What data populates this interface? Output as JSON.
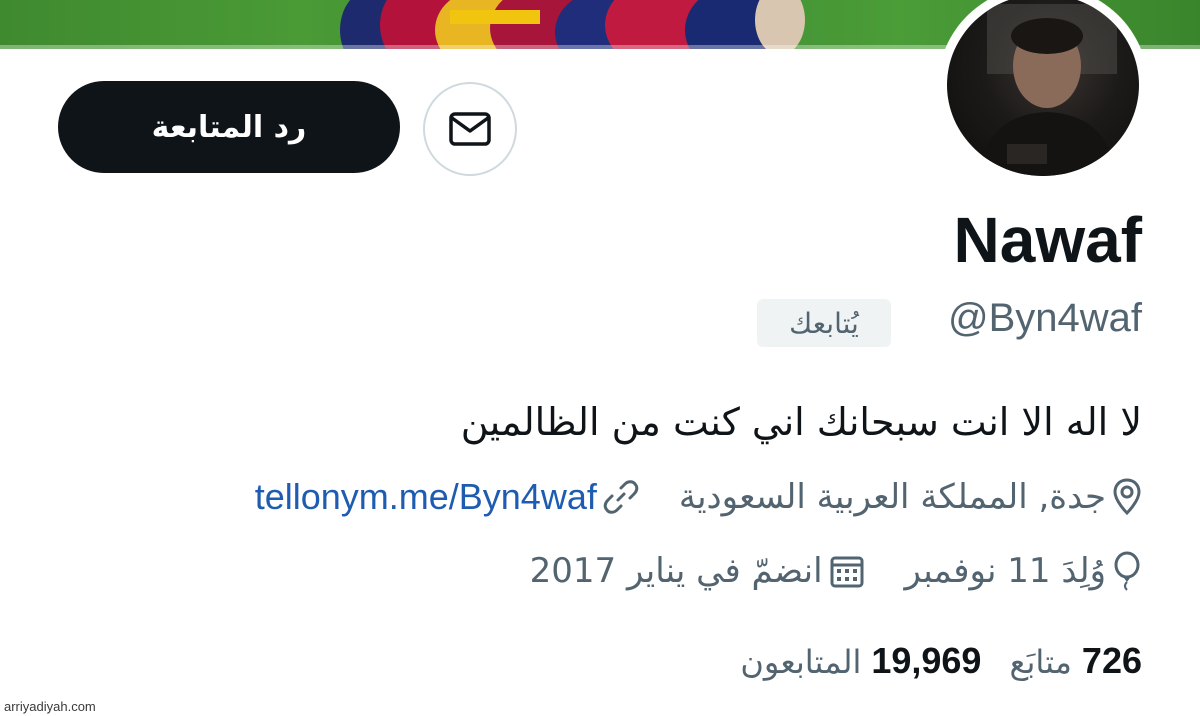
{
  "profile": {
    "display_name": "Nawaf",
    "handle": "@Byn4waf",
    "follows_you_badge": "يُتابعك",
    "bio": "لا اله الا انت سبحانك اني كنت من الظالمين",
    "location": "جدة, المملكة العربية السعودية",
    "website": "tellonym.me/Byn4waf",
    "birthday": "وُلِدَ 11 نوفمبر",
    "joined": "انضمّ في يناير 2017"
  },
  "actions": {
    "follow_back_label": "رد المتابعة",
    "message_icon": "envelope-icon"
  },
  "stats": {
    "following_count": "726",
    "following_label": "متابَع",
    "followers_count": "19,969",
    "followers_label": "المتابعون"
  },
  "icons": {
    "location": "location-pin-icon",
    "website": "link-icon",
    "birthday": "balloon-icon",
    "joined": "calendar-icon"
  },
  "colors": {
    "primary_text": "#0f1419",
    "secondary_text": "#536471",
    "link": "#1d5cb0",
    "button_dark": "#0f1419",
    "badge_bg": "#eff3f4",
    "banner_green": "#4a9a36"
  },
  "watermark": "arriyadiyah.com"
}
